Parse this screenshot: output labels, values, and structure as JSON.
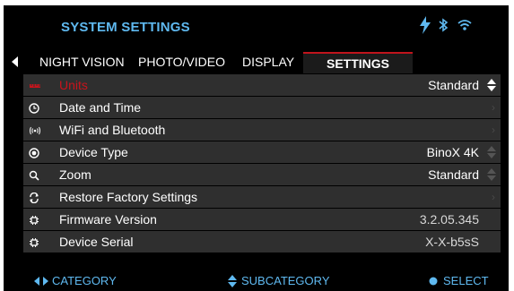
{
  "header": {
    "title": "SYSTEM SETTINGS",
    "status_icons": [
      "lightning-icon",
      "bluetooth-icon",
      "wifi-icon"
    ],
    "accent_color": "#5fb9f0"
  },
  "tabs": [
    {
      "label": "NIGHT VISION",
      "active": false
    },
    {
      "label": "PHOTO/VIDEO",
      "active": false
    },
    {
      "label": "DISPLAY",
      "active": false
    },
    {
      "label": "SETTINGS",
      "active": true
    }
  ],
  "rows": [
    {
      "label": "Units",
      "value": "Standard",
      "icon": "ruler-icon",
      "selected": true
    },
    {
      "label": "Date and Time",
      "value": "",
      "icon": "clock-icon"
    },
    {
      "label": "WiFi and Bluetooth",
      "value": "",
      "icon": "wireless-icon"
    },
    {
      "label": "Device Type",
      "value": "BinoX 4K",
      "icon": "target-icon"
    },
    {
      "label": "Zoom",
      "value": "Standard",
      "icon": "magnifier-icon"
    },
    {
      "label": "Restore Factory Settings",
      "value": "",
      "icon": "refresh-icon"
    },
    {
      "label": "Firmware Version",
      "value": "3.2.05.345",
      "icon": "chip-icon"
    },
    {
      "label": "Device Serial",
      "value": "X-X-b5sS",
      "icon": "chip-icon"
    }
  ],
  "footer": {
    "category": "CATEGORY",
    "subcategory": "SUBCATEGORY",
    "select": "SELECT"
  },
  "colors": {
    "selected_row_text": "#c8141c",
    "row_background": "#2f2f2f",
    "active_tab_border": "#c0141c"
  }
}
